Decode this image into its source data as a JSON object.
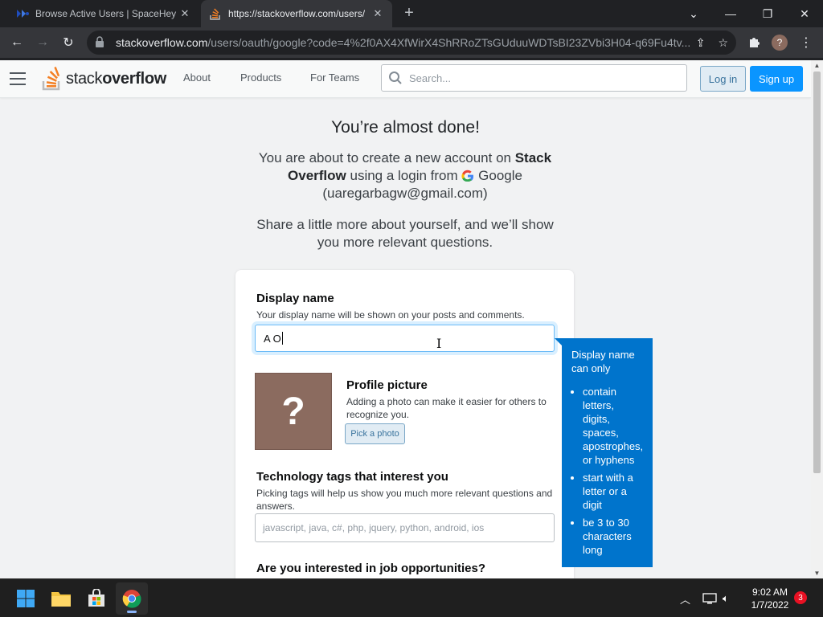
{
  "browser": {
    "tabs": [
      {
        "title": "Browse Active Users | SpaceHey",
        "icon": "spacehey-favicon"
      },
      {
        "title": "https://stackoverflow.com/users/",
        "icon": "stackoverflow-favicon"
      }
    ],
    "url_host": "stackoverflow.com",
    "url_rest": "/users/oauth/google?code=4%2f0AX4XfWirX4ShRRoZTsGUduuWDTsBI23ZVbi3H04-q69Fu4tv..."
  },
  "header": {
    "logo_prefix": "stack",
    "logo_suffix": "overflow",
    "nav": [
      "About",
      "Products",
      "For Teams"
    ],
    "search_placeholder": "Search...",
    "login_label": "Log in",
    "signup_label": "Sign up"
  },
  "intro": {
    "title": "You’re almost done!",
    "text_a": "You are about to create a new account on ",
    "site_name": "Stack Overflow",
    "text_b": " using a login from ",
    "provider": "Google",
    "email": "(uaregarbagw@gmail.com)",
    "share_text": "Share a little more about yourself, and we’ll show you more relevant questions."
  },
  "form": {
    "display_name_label": "Display name",
    "display_name_desc": "Your display name will be shown on your posts and comments.",
    "display_name_value": "A O",
    "profile_label": "Profile picture",
    "profile_desc": "Adding a photo can make it easier for others to recognize you.",
    "avatar_glyph": "?",
    "pick_photo_label": "Pick a photo",
    "tags_label": "Technology tags that interest you",
    "tags_desc": "Picking tags will help us show you much more relevant questions and answers.",
    "tags_placeholder": "javascript, java, c#, php, jquery, python, android, ios",
    "jobs_label": "Are you interested in job opportunities?"
  },
  "tooltip": {
    "heading": "Display name can only",
    "rules": [
      "contain letters, digits, spaces, apostrophes, or hyphens",
      "start with a letter or a digit",
      "be 3 to 30 characters long"
    ]
  },
  "taskbar": {
    "time": "9:02 AM",
    "date": "1/7/2022",
    "notification_count": "3"
  },
  "colors": {
    "so_orange": "#f48024",
    "so_blue": "#0a95ff",
    "tooltip_blue": "#0074cc"
  }
}
